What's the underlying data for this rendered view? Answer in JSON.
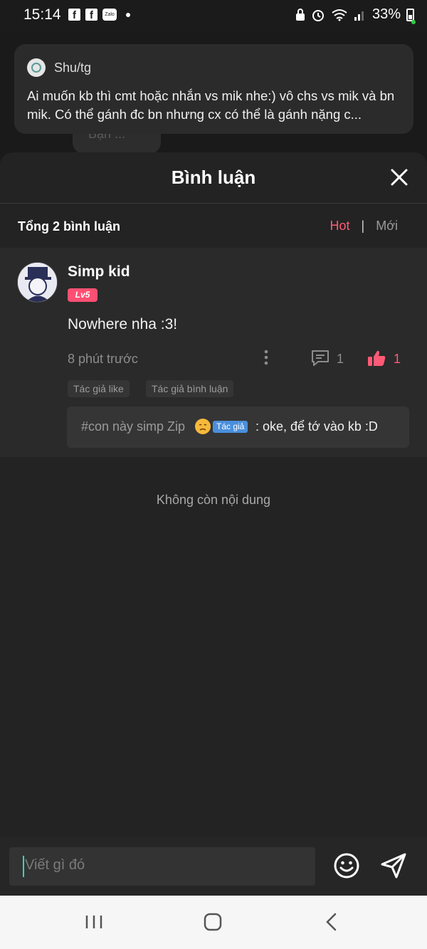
{
  "status_bar": {
    "time": "15:14",
    "battery_percent": "33%",
    "app_icons": [
      "facebook-icon",
      "facebook-icon",
      "zalo-icon"
    ],
    "zalo_label": "Zalo"
  },
  "background": {
    "bubble_text": "Bạn ..."
  },
  "notification": {
    "sender": "Shu/tg",
    "message": "Ai muốn kb thì cmt hoặc nhắn vs mik nhe:) vô chs vs mik và bn mik. Có thể gánh đc bn nhưng cx có thể là gánh nặng c..."
  },
  "sheet": {
    "title": "Bình luận",
    "total_comments": "Tổng 2 bình luận",
    "sort_hot": "Hot",
    "sort_separator": "|",
    "sort_new": "Mới",
    "empty_text": "Không còn nội dung"
  },
  "comment": {
    "author": "Simp kid",
    "level": "Lv5",
    "text": "Nowhere nha :3!",
    "time": "8 phút trước",
    "reply_count": "1",
    "like_count": "1",
    "tag_author_like": "Tác giả like",
    "tag_author_comment": "Tác giả bình luận",
    "reply": {
      "name": "#con này simp Zip",
      "badge": "Tác giả",
      "text": ": oke, để tớ vào kb :D"
    }
  },
  "input": {
    "placeholder": "Viết gì đó"
  },
  "colors": {
    "accent": "#ff5a76",
    "author_badge": "#4a8fdd",
    "caret": "#2ed9b5"
  }
}
